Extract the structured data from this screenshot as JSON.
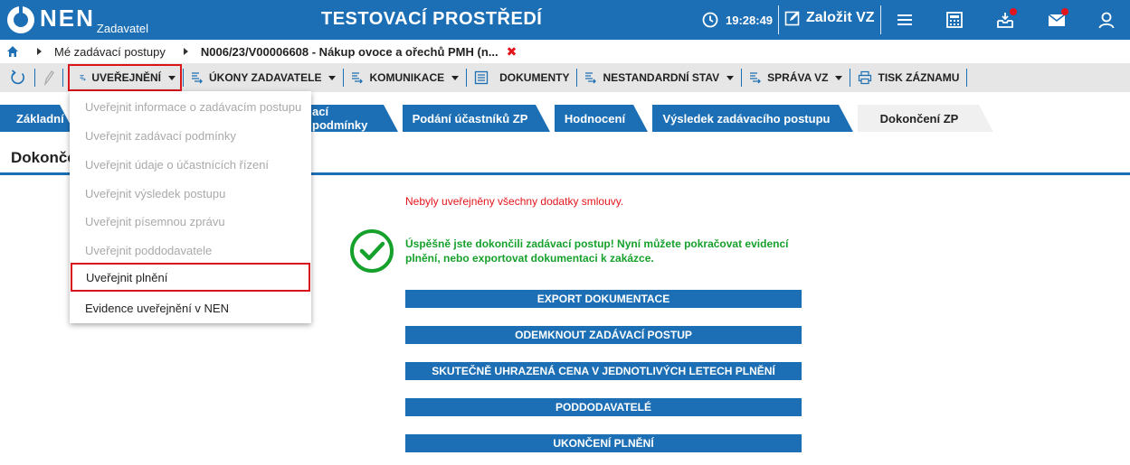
{
  "header": {
    "logo_text": "NEN",
    "logo_sub": "Zadavatel",
    "environment": "TESTOVACÍ PROSTŘEDÍ",
    "clock": "19:28:49",
    "create_label": "Založit VZ",
    "icons": [
      "clock-icon",
      "edit-icon",
      "menu-icon",
      "calculator-icon",
      "inbox-icon",
      "mail-icon",
      "user-icon"
    ]
  },
  "breadcrumb": {
    "items": [
      "Mé zadávací postupy",
      "N006/23/V00006608 - Nákup ovoce a ořechů PMH (n..."
    ],
    "close": "✖"
  },
  "toolbar": {
    "items": [
      {
        "label": "UVEŘEJNĚNÍ",
        "icon": "publish-icon",
        "dropdown": true
      },
      {
        "label": "ÚKONY ZADAVATELE",
        "icon": "actions-icon",
        "dropdown": true
      },
      {
        "label": "KOMUNIKACE",
        "icon": "communication-icon",
        "dropdown": true
      },
      {
        "label": "DOKUMENTY",
        "icon": "documents-icon",
        "dropdown": false
      },
      {
        "label": "NESTANDARDNÍ STAV",
        "icon": "nonstandard-icon",
        "dropdown": true
      },
      {
        "label": "SPRÁVA VZ",
        "icon": "admin-icon",
        "dropdown": true
      },
      {
        "label": "TISK ZÁZNAMU",
        "icon": "print-icon",
        "dropdown": false
      }
    ]
  },
  "tabs": [
    {
      "label": "Základní"
    },
    {
      "label": "ací podmínky"
    },
    {
      "label": "Podání účastníků ZP"
    },
    {
      "label": "Hodnocení"
    },
    {
      "label": "Výsledek zadávacího postupu"
    },
    {
      "label": "Dokončení ZP"
    }
  ],
  "section_title": "Dokonče",
  "content": {
    "warning": "Nebyly uveřejněny všechny dodatky smlouvy.",
    "success": "Úspěšně jste dokončili zadávací postup! Nyní můžete pokračovat evidencí plnění, nebo exportovat dokumentaci k zakázce.",
    "actions": [
      "EXPORT DOKUMENTACE",
      "ODEMKNOUT ZADÁVACÍ POSTUP",
      "SKUTEČNĚ UHRAZENÁ CENA V JEDNOTLIVÝCH LETECH PLNĚNÍ",
      "PODDODAVATELÉ",
      "UKONČENÍ PLNĚNÍ"
    ]
  },
  "menu": {
    "items": [
      {
        "label": "Uveřejnit informace o zadávacím postupu",
        "enabled": false
      },
      {
        "label": "Uveřejnit zadávací podmínky",
        "enabled": false
      },
      {
        "label": "Uveřejnit údaje o účastnících řízení",
        "enabled": false
      },
      {
        "label": "Uveřejnit výsledek postupu",
        "enabled": false
      },
      {
        "label": "Uveřejnit písemnou zprávu",
        "enabled": false
      },
      {
        "label": "Uveřejnit poddodavatele",
        "enabled": false
      },
      {
        "label": "Uveřejnit plnění",
        "enabled": true
      },
      {
        "label": "Evidence uveřejnění v NEN",
        "enabled": true
      }
    ]
  },
  "colors": {
    "brand": "#1c6fb5",
    "warning": "#e3141b",
    "success": "#16a12c",
    "highlight": "#d9141b"
  }
}
